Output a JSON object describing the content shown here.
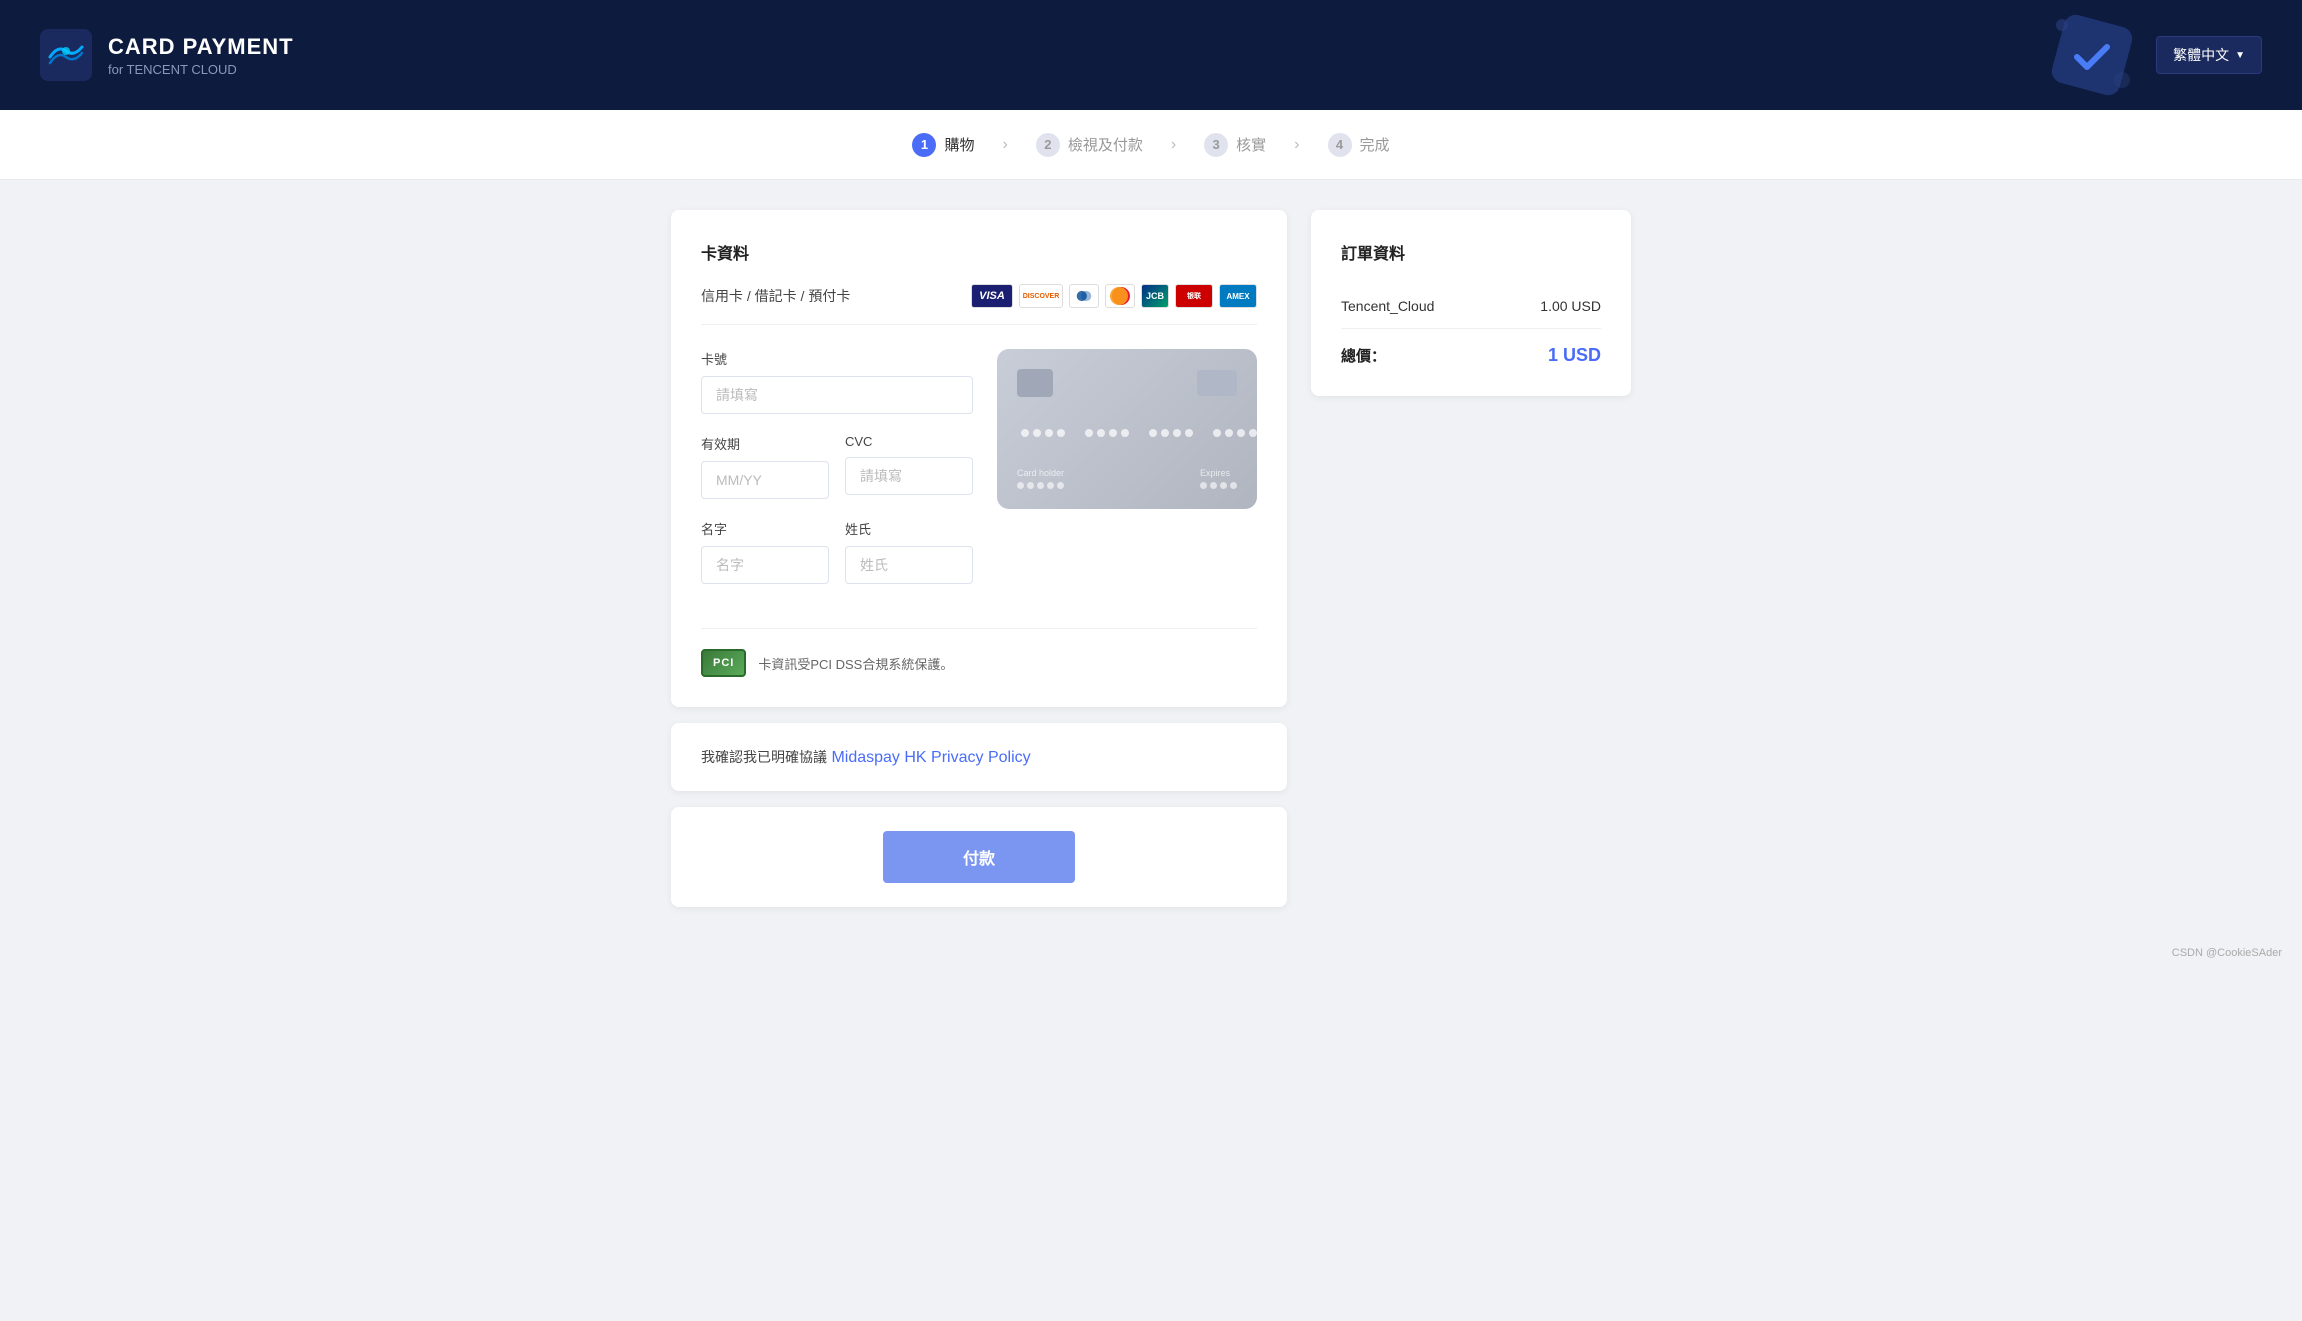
{
  "header": {
    "logo_alt": "Tencent Cloud logo",
    "title": "CARD PAYMENT",
    "subtitle": "for TENCENT CLOUD",
    "lang_button": "繁體中文",
    "lang_chevron": "▼"
  },
  "stepper": {
    "steps": [
      {
        "id": 1,
        "label": "購物",
        "active": true
      },
      {
        "id": 2,
        "label": "檢視及付款",
        "active": false
      },
      {
        "id": 3,
        "label": "核實",
        "active": false
      },
      {
        "id": 4,
        "label": "完成",
        "active": false
      }
    ]
  },
  "form": {
    "panel_title": "卡資料",
    "card_type_label": "信用卡 / 借記卡 / 預付卡",
    "card_number_label": "卡號",
    "card_number_placeholder": "請填寫",
    "expiry_label": "有效期",
    "expiry_placeholder": "MM/YY",
    "cvc_label": "CVC",
    "cvc_placeholder": "請填寫",
    "first_name_label": "名字",
    "first_name_placeholder": "名字",
    "last_name_label": "姓氏",
    "last_name_placeholder": "姓氏",
    "card_holder_label": "Card holder",
    "expires_label": "Expires",
    "pci_text": "卡資訊受PCI DSS合規系統保護。"
  },
  "agreement": {
    "text_before": "我確認我已明確協議",
    "link_text": "Midaspay HK Privacy Policy",
    "link_href": "#"
  },
  "submit": {
    "button_label": "付款"
  },
  "order": {
    "title": "訂單資料",
    "item_name": "Tencent_Cloud",
    "item_price": "1.00 USD",
    "total_label": "總價：",
    "total_price": "1 USD"
  },
  "footer": {
    "note": "CSDN @CookieSAder"
  }
}
